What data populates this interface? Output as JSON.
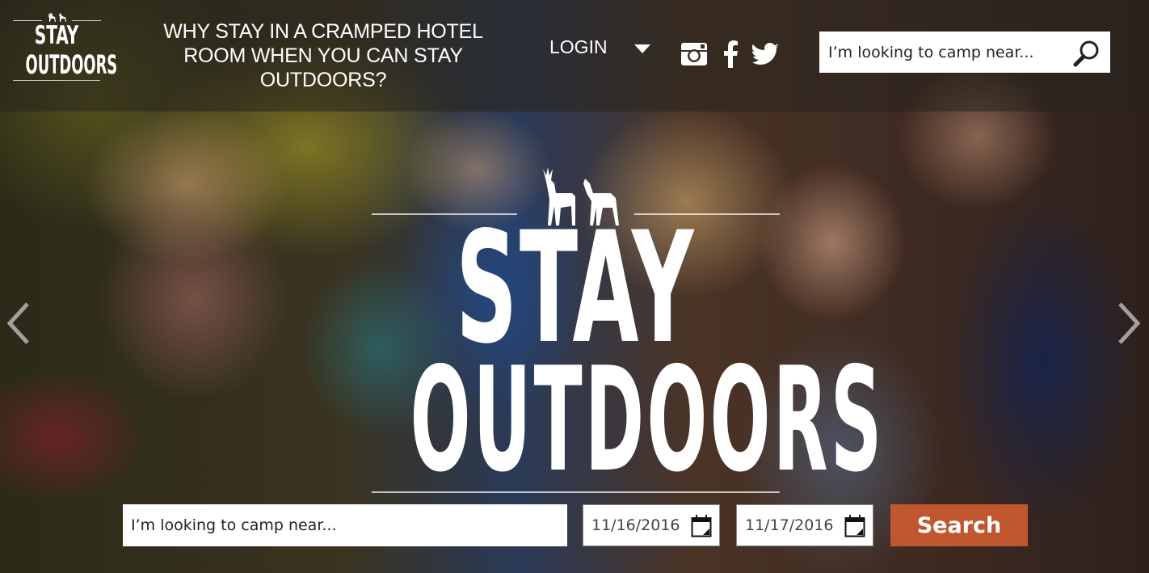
{
  "brand": {
    "logo_line1": "STAY",
    "logo_line2": "OUTDOORS",
    "accent_color": "#c1572e"
  },
  "header": {
    "tagline": "WHY STAY IN A CRAMPED HOTEL ROOM WHEN YOU CAN STAY OUTDOORS?",
    "login_label": "LOGIN",
    "social_icons": [
      "instagram-icon",
      "facebook-icon",
      "twitter-icon"
    ],
    "search": {
      "placeholder": "I’m looking to camp near...",
      "value": ""
    }
  },
  "hero": {
    "title_line1": "STAY",
    "title_line2": "OUTDOORS",
    "prev_icon": "chevron-left-icon",
    "next_icon": "chevron-right-icon"
  },
  "search_form": {
    "location_placeholder": "I’m looking to camp near...",
    "location_value": "",
    "check_in": "11/16/2016",
    "check_out": "11/17/2016",
    "submit_label": "Search"
  }
}
